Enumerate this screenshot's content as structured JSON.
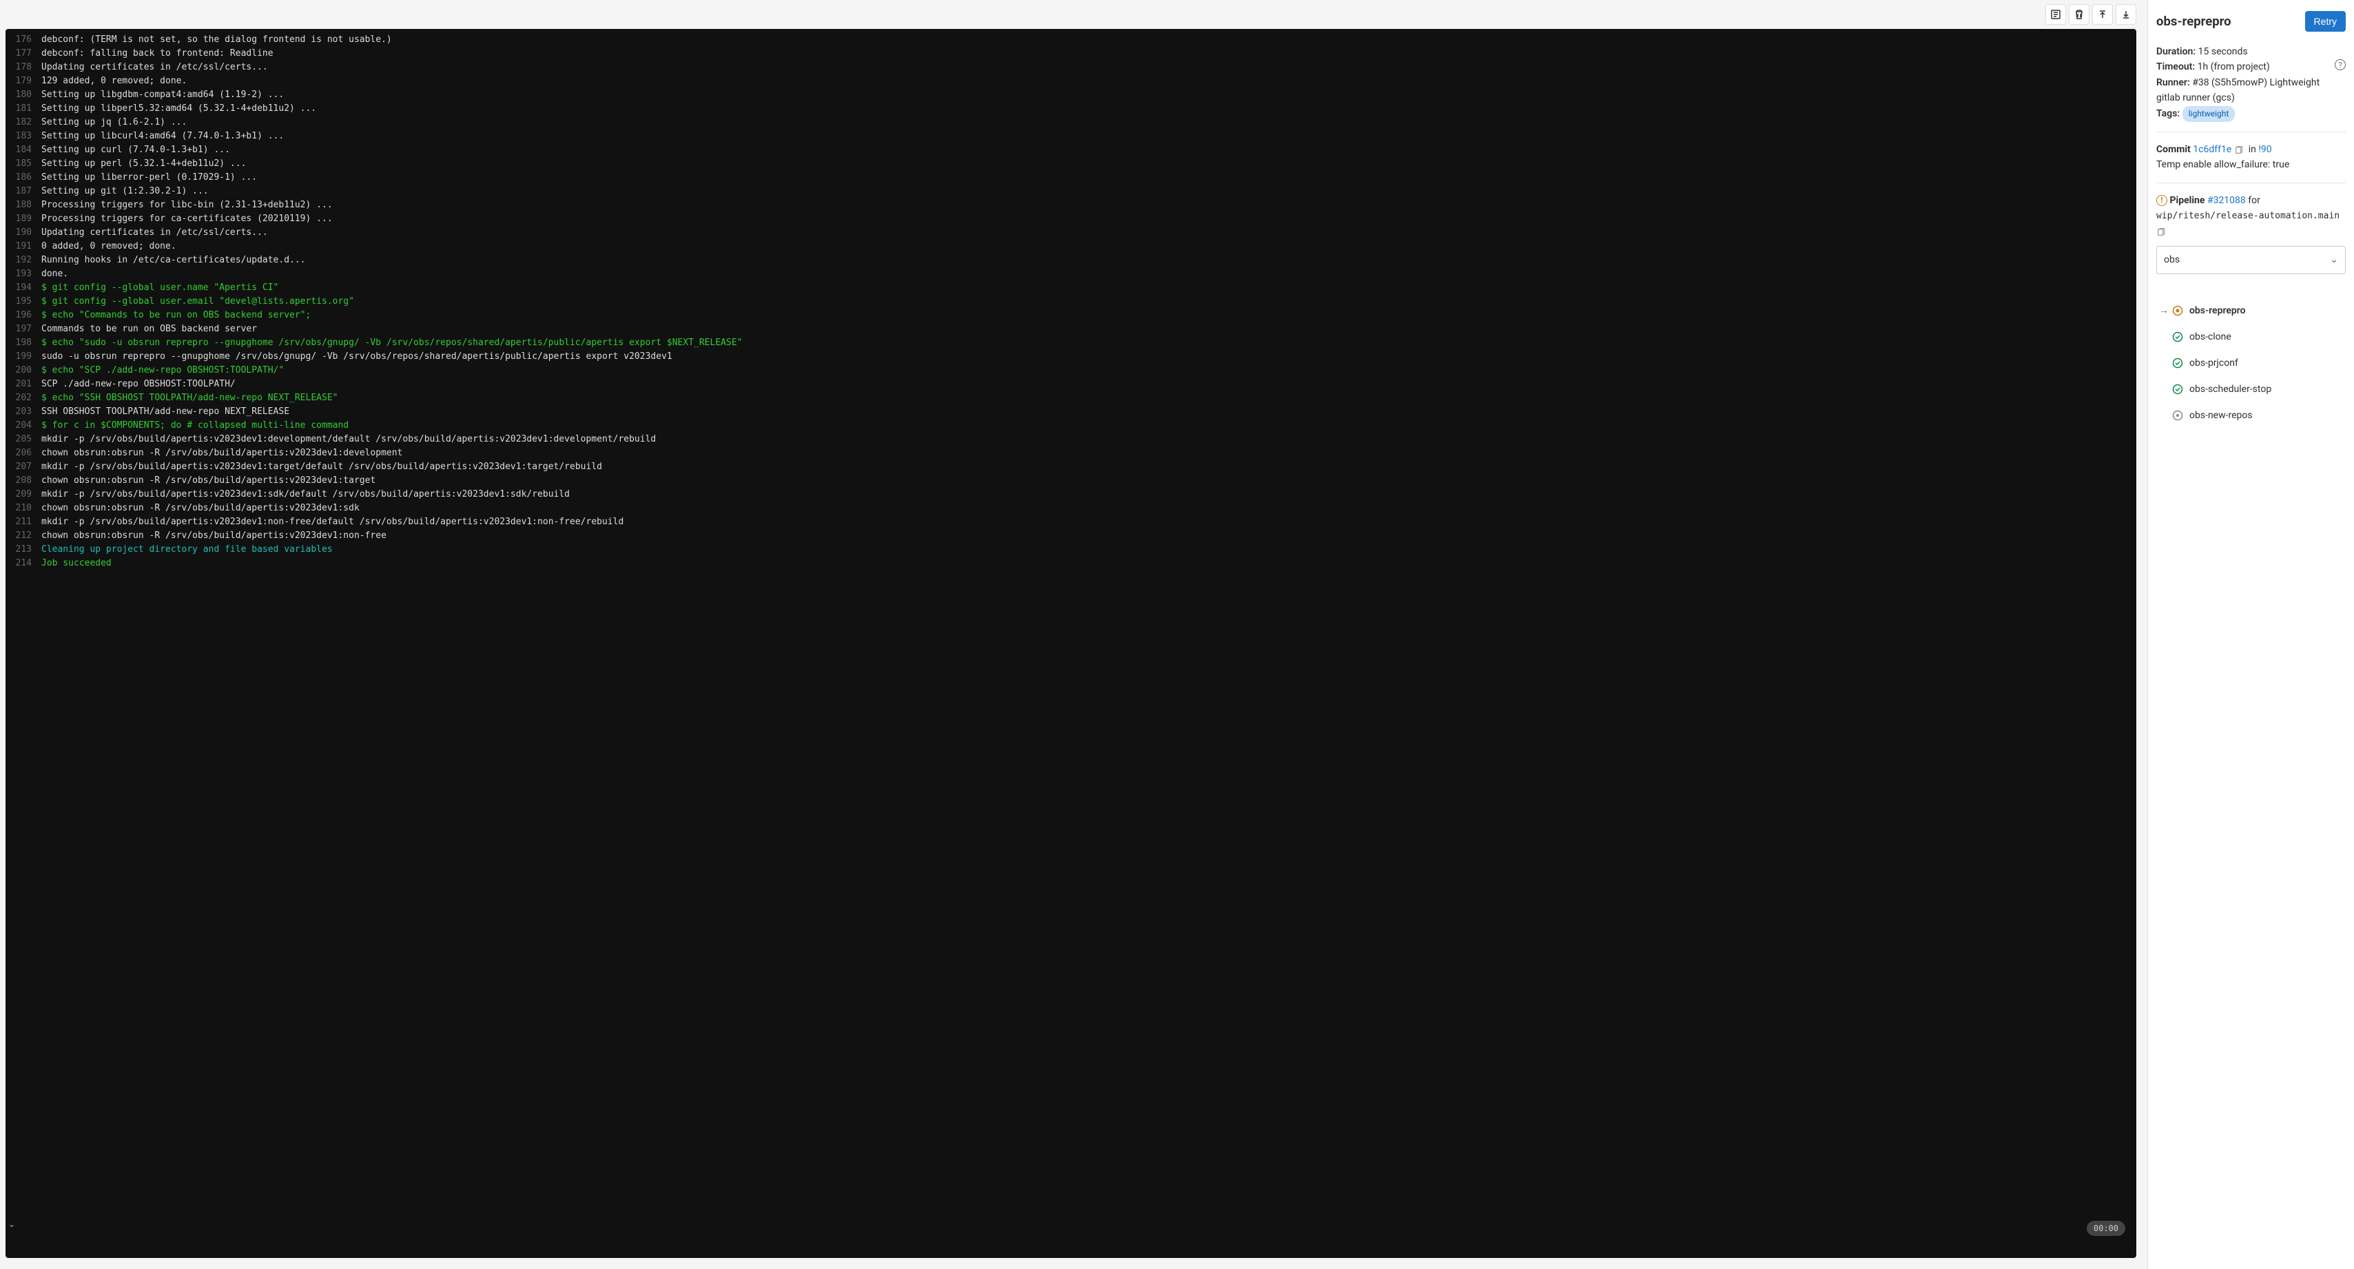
{
  "timer": "00:00",
  "log": [
    {
      "n": 176,
      "t": "debconf: (TERM is not set, so the dialog frontend is not usable.)",
      "c": ""
    },
    {
      "n": 177,
      "t": "debconf: falling back to frontend: Readline",
      "c": ""
    },
    {
      "n": 178,
      "t": "Updating certificates in /etc/ssl/certs...",
      "c": ""
    },
    {
      "n": 179,
      "t": "129 added, 0 removed; done.",
      "c": ""
    },
    {
      "n": 180,
      "t": "Setting up libgdbm-compat4:amd64 (1.19-2) ...",
      "c": ""
    },
    {
      "n": 181,
      "t": "Setting up libperl5.32:amd64 (5.32.1-4+deb11u2) ...",
      "c": ""
    },
    {
      "n": 182,
      "t": "Setting up jq (1.6-2.1) ...",
      "c": ""
    },
    {
      "n": 183,
      "t": "Setting up libcurl4:amd64 (7.74.0-1.3+b1) ...",
      "c": ""
    },
    {
      "n": 184,
      "t": "Setting up curl (7.74.0-1.3+b1) ...",
      "c": ""
    },
    {
      "n": 185,
      "t": "Setting up perl (5.32.1-4+deb11u2) ...",
      "c": ""
    },
    {
      "n": 186,
      "t": "Setting up liberror-perl (0.17029-1) ...",
      "c": ""
    },
    {
      "n": 187,
      "t": "Setting up git (1:2.30.2-1) ...",
      "c": ""
    },
    {
      "n": 188,
      "t": "Processing triggers for libc-bin (2.31-13+deb11u2) ...",
      "c": ""
    },
    {
      "n": 189,
      "t": "Processing triggers for ca-certificates (20210119) ...",
      "c": ""
    },
    {
      "n": 190,
      "t": "Updating certificates in /etc/ssl/certs...",
      "c": ""
    },
    {
      "n": 191,
      "t": "0 added, 0 removed; done.",
      "c": ""
    },
    {
      "n": 192,
      "t": "Running hooks in /etc/ca-certificates/update.d...",
      "c": ""
    },
    {
      "n": 193,
      "t": "done.",
      "c": ""
    },
    {
      "n": 194,
      "t": "$ git config --global user.name \"Apertis CI\"",
      "c": "cmd"
    },
    {
      "n": 195,
      "t": "$ git config --global user.email \"devel@lists.apertis.org\"",
      "c": "cmd"
    },
    {
      "n": 196,
      "t": "$ echo \"Commands to be run on OBS backend server\";",
      "c": "cmd"
    },
    {
      "n": 197,
      "t": "Commands to be run on OBS backend server",
      "c": ""
    },
    {
      "n": 198,
      "t": "$ echo \"sudo -u obsrun reprepro --gnupghome /srv/obs/gnupg/ -Vb /srv/obs/repos/shared/apertis/public/apertis export $NEXT_RELEASE\"",
      "c": "cmd"
    },
    {
      "n": 199,
      "t": "sudo -u obsrun reprepro --gnupghome /srv/obs/gnupg/ -Vb /srv/obs/repos/shared/apertis/public/apertis export v2023dev1",
      "c": ""
    },
    {
      "n": 200,
      "t": "$ echo \"SCP ./add-new-repo OBSHOST:TOOLPATH/\"",
      "c": "cmd"
    },
    {
      "n": 201,
      "t": "SCP ./add-new-repo OBSHOST:TOOLPATH/",
      "c": ""
    },
    {
      "n": 202,
      "t": "$ echo \"SSH OBSHOST TOOLPATH/add-new-repo NEXT_RELEASE\"",
      "c": "cmd"
    },
    {
      "n": 203,
      "t": "SSH OBSHOST TOOLPATH/add-new-repo NEXT_RELEASE",
      "c": ""
    },
    {
      "n": 204,
      "t": "$ for c in $COMPONENTS; do # collapsed multi-line command",
      "c": "cmd"
    },
    {
      "n": 205,
      "t": "mkdir -p /srv/obs/build/apertis:v2023dev1:development/default /srv/obs/build/apertis:v2023dev1:development/rebuild",
      "c": ""
    },
    {
      "n": 206,
      "t": "chown obsrun:obsrun -R /srv/obs/build/apertis:v2023dev1:development",
      "c": ""
    },
    {
      "n": 207,
      "t": "mkdir -p /srv/obs/build/apertis:v2023dev1:target/default /srv/obs/build/apertis:v2023dev1:target/rebuild",
      "c": ""
    },
    {
      "n": 208,
      "t": "chown obsrun:obsrun -R /srv/obs/build/apertis:v2023dev1:target",
      "c": ""
    },
    {
      "n": 209,
      "t": "mkdir -p /srv/obs/build/apertis:v2023dev1:sdk/default /srv/obs/build/apertis:v2023dev1:sdk/rebuild",
      "c": ""
    },
    {
      "n": 210,
      "t": "chown obsrun:obsrun -R /srv/obs/build/apertis:v2023dev1:sdk",
      "c": ""
    },
    {
      "n": 211,
      "t": "mkdir -p /srv/obs/build/apertis:v2023dev1:non-free/default /srv/obs/build/apertis:v2023dev1:non-free/rebuild",
      "c": ""
    },
    {
      "n": 212,
      "t": "chown obsrun:obsrun -R /srv/obs/build/apertis:v2023dev1:non-free",
      "c": ""
    },
    {
      "n": 213,
      "t": "Cleaning up project directory and file based variables",
      "c": "cyan"
    },
    {
      "n": 214,
      "t": "Job succeeded",
      "c": "green2"
    }
  ],
  "sidebar": {
    "title": "obs-reprepro",
    "retry": "Retry",
    "duration_label": "Duration:",
    "duration_value": "15 seconds",
    "timeout_label": "Timeout:",
    "timeout_value": "1h (from project)",
    "runner_label": "Runner:",
    "runner_value": "#38 (S5h5mowP) Lightweight gitlab runner (gcs)",
    "tags_label": "Tags:",
    "tag": "lightweight",
    "commit_label": "Commit",
    "commit_sha": "1c6dff1e",
    "commit_in": "in",
    "commit_mr": "!90",
    "commit_msg": "Temp enable allow_failure: true",
    "pipeline_label": "Pipeline",
    "pipeline_id": "#321088",
    "pipeline_for": "for",
    "pipeline_branch": "wip/ritesh/release-automation.main",
    "stage": "obs",
    "jobs": [
      {
        "name": "obs-reprepro",
        "status": "pending",
        "active": true
      },
      {
        "name": "obs-clone",
        "status": "success",
        "active": false
      },
      {
        "name": "obs-prjconf",
        "status": "success",
        "active": false
      },
      {
        "name": "obs-scheduler-stop",
        "status": "success",
        "active": false
      },
      {
        "name": "obs-new-repos",
        "status": "created",
        "active": false
      }
    ]
  }
}
